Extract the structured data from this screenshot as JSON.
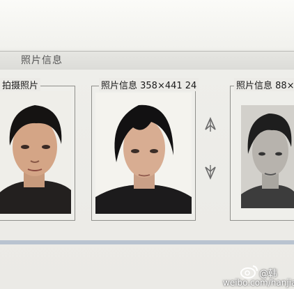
{
  "section": {
    "title": "照片信息"
  },
  "panels": [
    {
      "label": "拍摄照片"
    },
    {
      "label": "照片信息 358×441 24"
    },
    {
      "label": "照片信息 88×"
    }
  ],
  "watermark": {
    "name": "@韩",
    "url": "weibo.com/hanjia"
  },
  "icons": [
    "up-arrow-icon",
    "down-arrow-icon",
    "weibo-logo-icon"
  ]
}
